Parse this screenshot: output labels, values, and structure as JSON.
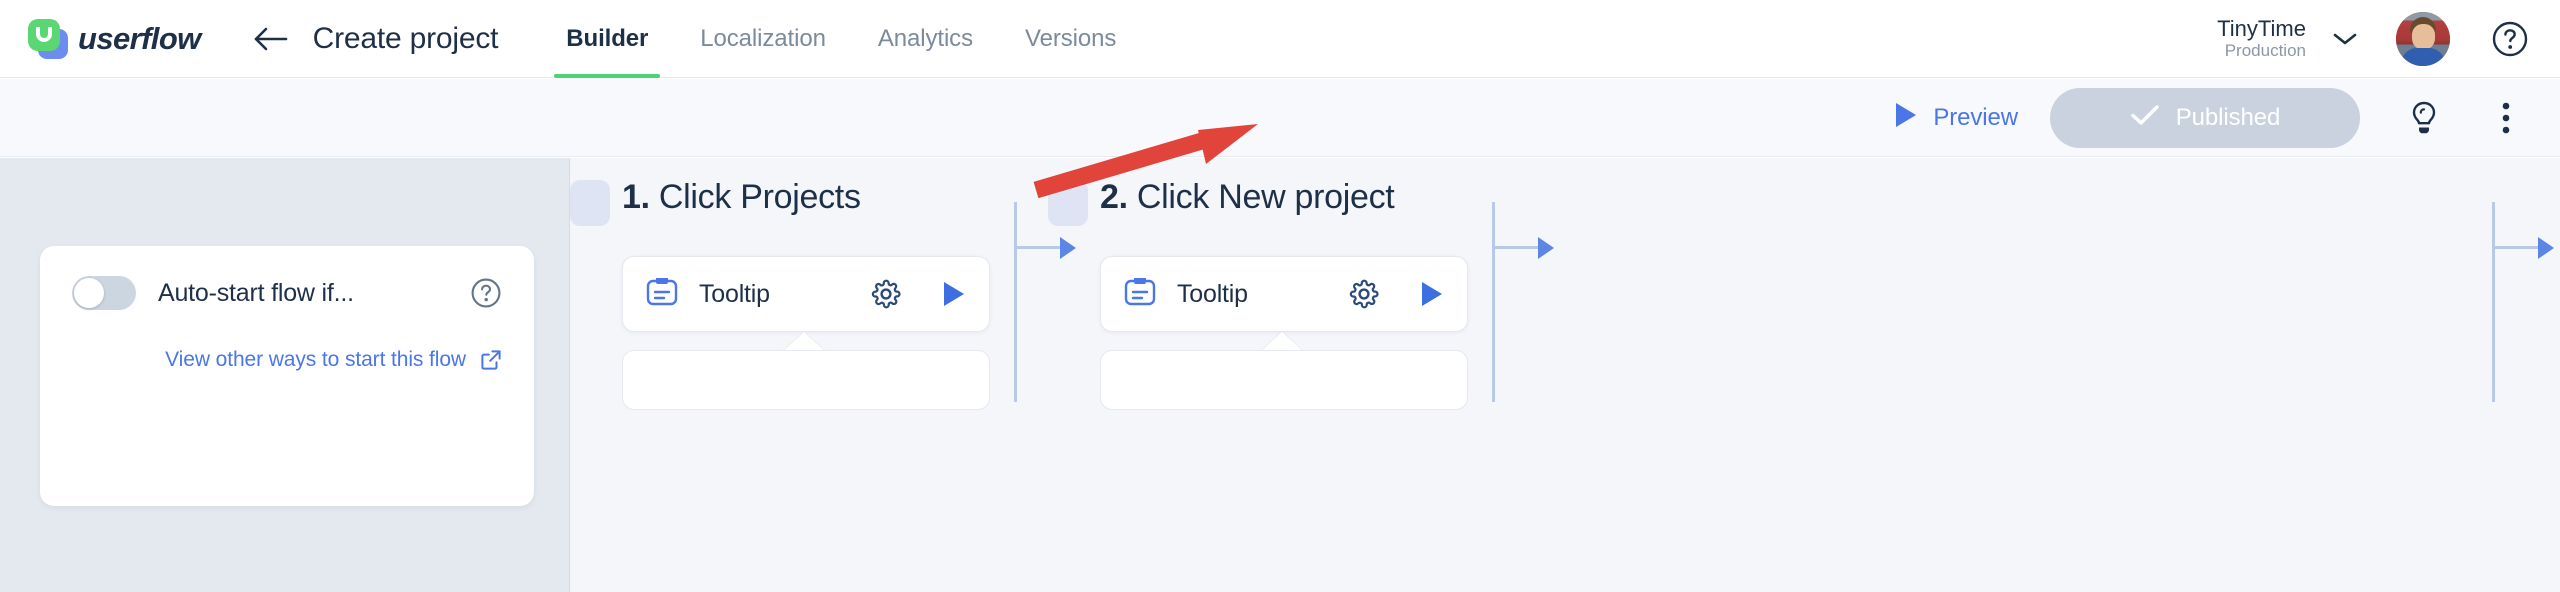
{
  "header": {
    "logo_text": "userflow",
    "back_icon": "back-arrow-icon",
    "page_title": "Create project",
    "tabs": [
      {
        "label": "Builder",
        "active": true
      },
      {
        "label": "Localization",
        "active": false
      },
      {
        "label": "Analytics",
        "active": false
      },
      {
        "label": "Versions",
        "active": false
      }
    ],
    "org": {
      "name": "TinyTime",
      "environment": "Production",
      "chevron_icon": "chevron-down-icon"
    },
    "avatar_icon": "user-avatar",
    "help_icon": "help-circle-icon"
  },
  "toolbar": {
    "preview_label": "Preview",
    "preview_icon": "play-icon",
    "published_label": "Published",
    "published_icon": "check-icon",
    "tips_icon": "lightbulb-icon",
    "more_icon": "more-vertical-icon",
    "published_bg": "#c9d2de",
    "accent_blue": "#4a76e8"
  },
  "side_panel": {
    "auto_start_label": "Auto-start flow if...",
    "auto_start_toggle": "off",
    "auto_start_help_icon": "help-circle-icon",
    "other_ways_link": "View other ways to start this flow",
    "external_link_icon": "external-link-icon"
  },
  "steps": [
    {
      "number": "1.",
      "title": "Click Projects",
      "node_label": "Tooltip",
      "node_icon": "tooltip-icon",
      "gear_icon": "gear-icon",
      "play_icon": "play-icon"
    },
    {
      "number": "2.",
      "title": "Click New project",
      "node_label": "Tooltip",
      "node_icon": "tooltip-icon",
      "gear_icon": "gear-icon",
      "play_icon": "play-icon"
    }
  ],
  "annotation": {
    "arrow_color": "#e0443a",
    "points_to": "Published"
  }
}
